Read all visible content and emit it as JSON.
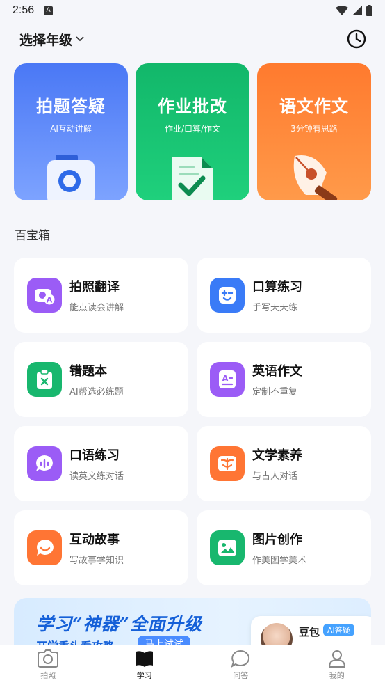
{
  "status_bar": {
    "time": "2:56"
  },
  "header": {
    "grade_selector": "选择年级"
  },
  "hero_cards": [
    {
      "title": "拍题答疑",
      "subtitle": "AI互动讲解"
    },
    {
      "title": "作业批改",
      "subtitle": "作业/口算/作文"
    },
    {
      "title": "语文作文",
      "subtitle": "3分钟有思路"
    }
  ],
  "toolbox": {
    "title": "百宝箱",
    "items": [
      {
        "name": "拍照翻译",
        "desc": "能点读会讲解"
      },
      {
        "name": "口算练习",
        "desc": "手写天天练"
      },
      {
        "name": "错题本",
        "desc": "AI帮选必练题"
      },
      {
        "name": "英语作文",
        "desc": "定制不重复"
      },
      {
        "name": "口语练习",
        "desc": "读英文练对话"
      },
      {
        "name": "文学素养",
        "desc": "与古人对话"
      },
      {
        "name": "互动故事",
        "desc": "写故事学知识"
      },
      {
        "name": "图片创作",
        "desc": "作美图学美术"
      }
    ]
  },
  "banner": {
    "title": "学习“神器”全面升级",
    "subtitle": "开学重头看攻略",
    "button": "马上试试",
    "bot_name": "豆包",
    "bot_tag": "AI答疑"
  },
  "tabbar": [
    {
      "label": "拍照",
      "icon": "camera-icon"
    },
    {
      "label": "学习",
      "icon": "book-icon",
      "active": true
    },
    {
      "label": "问答",
      "icon": "chat-icon"
    },
    {
      "label": "我的",
      "icon": "user-icon"
    }
  ],
  "colors": {
    "blue_card": "#4a78f5",
    "green_card": "#12b76a",
    "orange_card": "#ff7a2e",
    "purple_icon": "#9b5cf6",
    "blue_icon": "#3a7bf7",
    "green_icon": "#18b76e",
    "orange_icon": "#ff7534"
  }
}
